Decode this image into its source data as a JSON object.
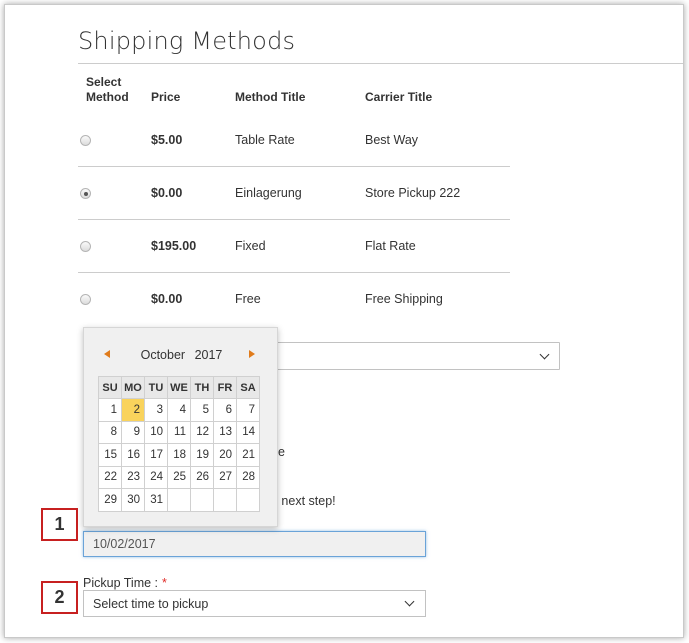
{
  "section_title": "Shipping Methods",
  "table": {
    "headers": {
      "select_line1": "Select",
      "select_line2": "Method",
      "price": "Price",
      "method_title": "Method Title",
      "carrier_title": "Carrier Title"
    },
    "rows": [
      {
        "price": "$5.00",
        "method": "Table Rate",
        "carrier": "Best Way",
        "selected": false
      },
      {
        "price": "$0.00",
        "method": "Einlagerung",
        "carrier": "Store Pickup 222",
        "selected": true
      },
      {
        "price": "$195.00",
        "method": "Fixed",
        "carrier": "Flat Rate",
        "selected": false
      },
      {
        "price": "$0.00",
        "method": "Free",
        "carrier": "Free Shipping",
        "selected": false
      }
    ]
  },
  "partial_text": {
    "line1": "de",
    "line2": "o next step!"
  },
  "datepicker": {
    "month": "October",
    "year": "2017",
    "weekdays": [
      "SU",
      "MO",
      "TU",
      "WE",
      "TH",
      "FR",
      "SA"
    ],
    "weeks": [
      [
        "1",
        "2",
        "3",
        "4",
        "5",
        "6",
        "7"
      ],
      [
        "8",
        "9",
        "10",
        "11",
        "12",
        "13",
        "14"
      ],
      [
        "15",
        "16",
        "17",
        "18",
        "19",
        "20",
        "21"
      ],
      [
        "22",
        "23",
        "24",
        "25",
        "26",
        "27",
        "28"
      ],
      [
        "29",
        "30",
        "31",
        "",
        "",
        "",
        ""
      ]
    ],
    "today": "2",
    "accent_color": "#e07b1b",
    "today_color": "#f9d35c"
  },
  "pickup_date": {
    "value": "10/02/2017"
  },
  "pickup_time": {
    "label": "Pickup Time :",
    "required_mark": "*",
    "placeholder": "Select time to pickup"
  },
  "callouts": {
    "one": "1",
    "two": "2",
    "border_color": "#c72020"
  }
}
